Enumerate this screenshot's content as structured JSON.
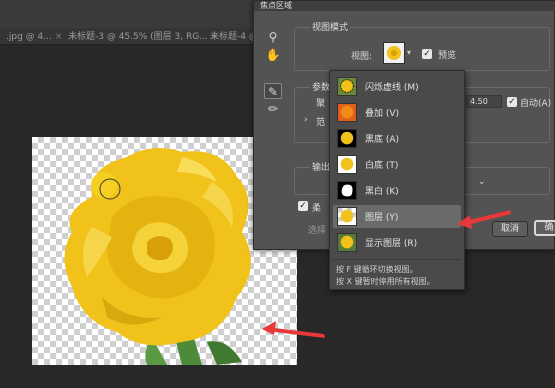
{
  "tabs": [
    {
      "label": ".jpg @ 4...",
      "close": "×"
    },
    {
      "label": "未标题-3 @ 45.5% (图层 3, RG...",
      "close": "×"
    },
    {
      "label": "未标题-4 @ 8",
      "close": "×"
    }
  ],
  "dialog": {
    "title": "焦点区域",
    "view_mode_group": "视图模式",
    "view_label": "视图:",
    "preview_label": "预览",
    "params_group": "参数",
    "param_letters": [
      "聚",
      "范"
    ],
    "param_value": "4.50",
    "auto_label": "自动(A)",
    "output_group": "输出",
    "soften_label": "柔",
    "select_label": "选择",
    "cancel": "取消",
    "ok": "确"
  },
  "menu": {
    "items": [
      {
        "label": "闪烁虚线 (M)",
        "thumb": "marching"
      },
      {
        "label": "叠加 (V)",
        "thumb": "overlay"
      },
      {
        "label": "黑底 (A)",
        "thumb": "black"
      },
      {
        "label": "白底 (T)",
        "thumb": "white"
      },
      {
        "label": "黑白 (K)",
        "thumb": "bw"
      },
      {
        "label": "图层 (Y)",
        "thumb": "layer",
        "selected": true
      },
      {
        "label": "显示图层 (R)",
        "thumb": "reveal"
      }
    ],
    "hint1": "按 F 键循环切换视图。",
    "hint2": "按 X 键暂时停用所有视图。"
  },
  "colors": {
    "arrow": "#e8383a",
    "flower": "#f2c318",
    "dialog_bg": "#535353"
  },
  "icons": {
    "zoom": "magnifier-icon",
    "hand": "hand-icon",
    "brush_add": "brush-add-icon",
    "brush_sub": "brush-subtract-icon"
  }
}
